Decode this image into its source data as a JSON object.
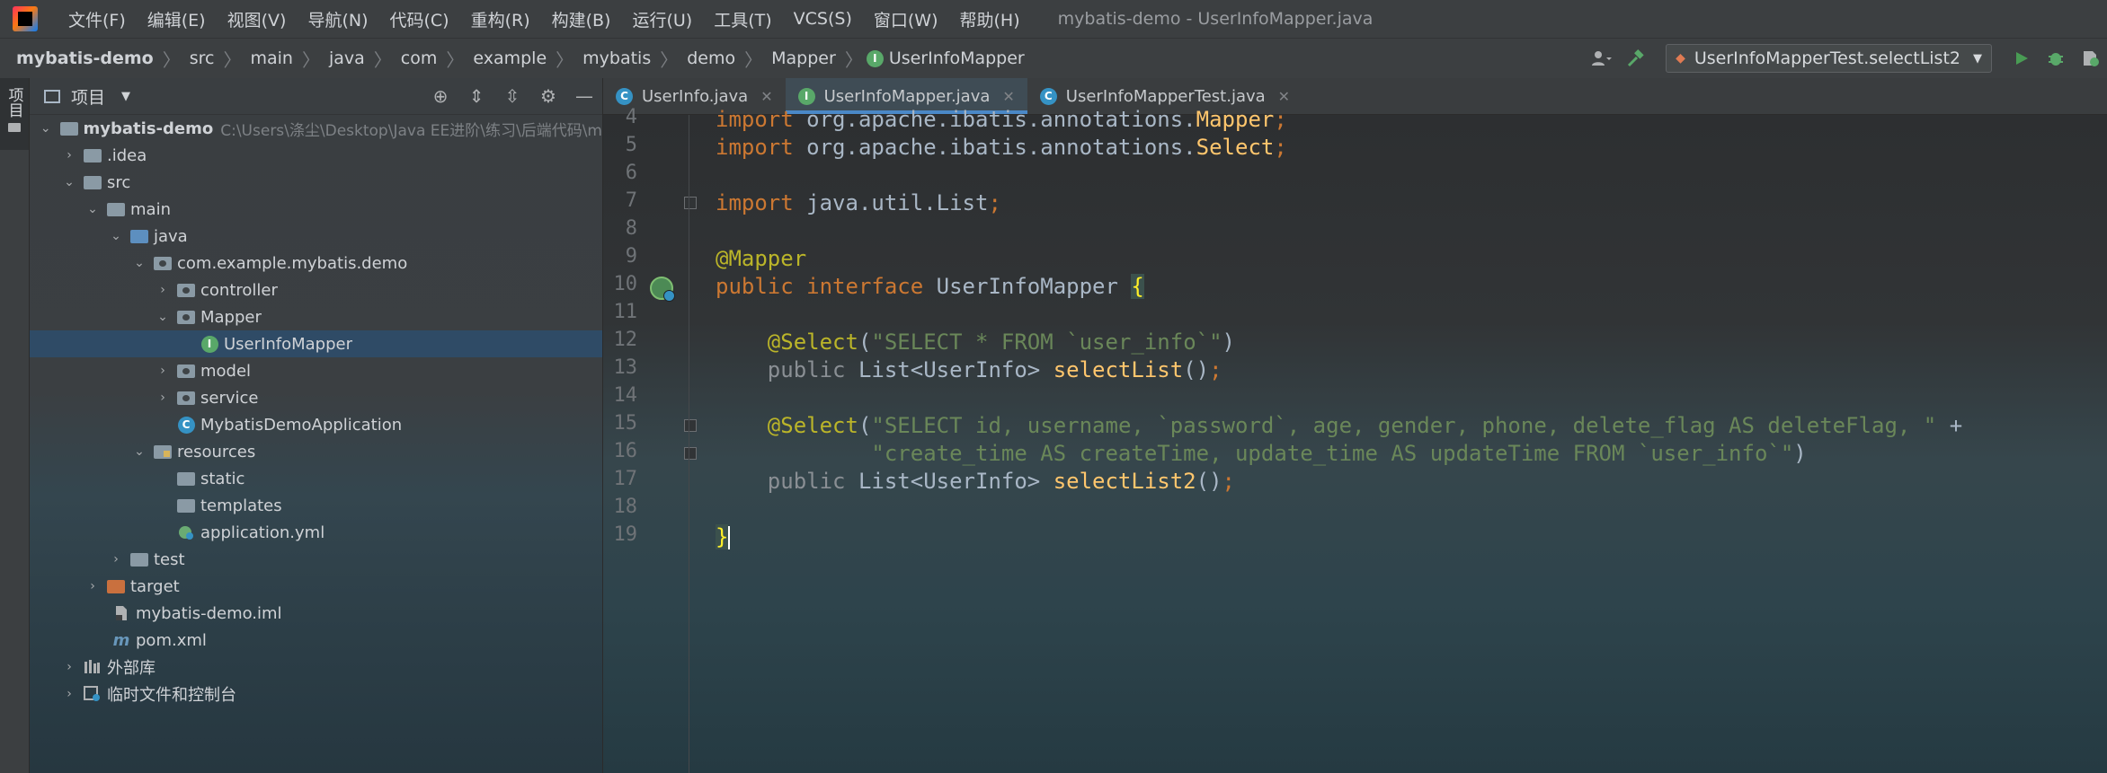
{
  "menubar": {
    "items": [
      "文件(F)",
      "编辑(E)",
      "视图(V)",
      "导航(N)",
      "代码(C)",
      "重构(R)",
      "构建(B)",
      "运行(U)",
      "工具(T)",
      "VCS(S)",
      "窗口(W)",
      "帮助(H)"
    ],
    "window_title": "mybatis-demo - UserInfoMapper.java"
  },
  "breadcrumb": [
    "mybatis-demo",
    "src",
    "main",
    "java",
    "com",
    "example",
    "mybatis",
    "demo",
    "Mapper",
    "UserInfoMapper"
  ],
  "run_config": {
    "label": "UserInfoMapperTest.selectList2"
  },
  "left_stripe": {
    "label": "项目"
  },
  "project_panel": {
    "title": "项目",
    "tree": [
      {
        "label": "mybatis-demo",
        "path": "C:\\Users\\涤尘\\Desktop\\Java EE进阶\\练习\\后端代码\\m"
      },
      {
        "label": ".idea"
      },
      {
        "label": "src"
      },
      {
        "label": "main"
      },
      {
        "label": "java"
      },
      {
        "label": "com.example.mybatis.demo"
      },
      {
        "label": "controller"
      },
      {
        "label": "Mapper"
      },
      {
        "label": "UserInfoMapper"
      },
      {
        "label": "model"
      },
      {
        "label": "service"
      },
      {
        "label": "MybatisDemoApplication"
      },
      {
        "label": "resources"
      },
      {
        "label": "static"
      },
      {
        "label": "templates"
      },
      {
        "label": "application.yml"
      },
      {
        "label": "test"
      },
      {
        "label": "target"
      },
      {
        "label": "mybatis-demo.iml"
      },
      {
        "label": "pom.xml"
      },
      {
        "label": "外部库"
      },
      {
        "label": "临时文件和控制台"
      }
    ]
  },
  "editor": {
    "tabs": [
      {
        "label": "UserInfo.java"
      },
      {
        "label": "UserInfoMapper.java"
      },
      {
        "label": "UserInfoMapperTest.java"
      }
    ],
    "line_numbers": [
      "4",
      "5",
      "6",
      "7",
      "8",
      "9",
      "10",
      "11",
      "12",
      "13",
      "14",
      "15",
      "16",
      "17",
      "18",
      "19"
    ],
    "code": {
      "l4": {
        "kw": "import",
        "pkg": " org.apache.ibatis.annotations.",
        "name": "Mapper",
        "semi": ";"
      },
      "l5": {
        "kw": "import",
        "pkg": " org.apache.ibatis.annotations.",
        "name": "Select",
        "semi": ";"
      },
      "l7": {
        "kw": "import",
        "pkg": " java.util.List",
        "semi": ";"
      },
      "l9": {
        "ann": "@Mapper"
      },
      "l10": {
        "kw1": "public",
        "kw2": " interface",
        "name": " UserInfoMapper ",
        "brace": "{"
      },
      "l12": {
        "ann": "@Select",
        "open": "(",
        "str": "\"SELECT * FROM `user_info`\"",
        "close": ")"
      },
      "l13": {
        "kw": "public",
        "type": " List<UserInfo> ",
        "fn": "selectList",
        "paren": "()",
        "semi": ";"
      },
      "l15": {
        "ann": "@Select",
        "open": "(",
        "str": "\"SELECT id, username, `password`, age, gender, phone, delete_flag AS deleteFlag, \"",
        "plus": " +"
      },
      "l16": {
        "str": "\"create_time AS createTime, update_time AS updateTime FROM `user_info`\"",
        "close": ")"
      },
      "l17": {
        "kw": "public",
        "type": " List<UserInfo> ",
        "fn": "selectList2",
        "paren": "()",
        "semi": ";"
      },
      "l19": {
        "brace": "}"
      }
    }
  },
  "colors": {
    "keyword": "#cc7832",
    "annotation": "#bbb529",
    "string": "#6a8759",
    "function": "#ffc66d",
    "text": "#a9b7c6",
    "selection": "#2f4b66",
    "active_tab_underline": "#4a88c7"
  }
}
